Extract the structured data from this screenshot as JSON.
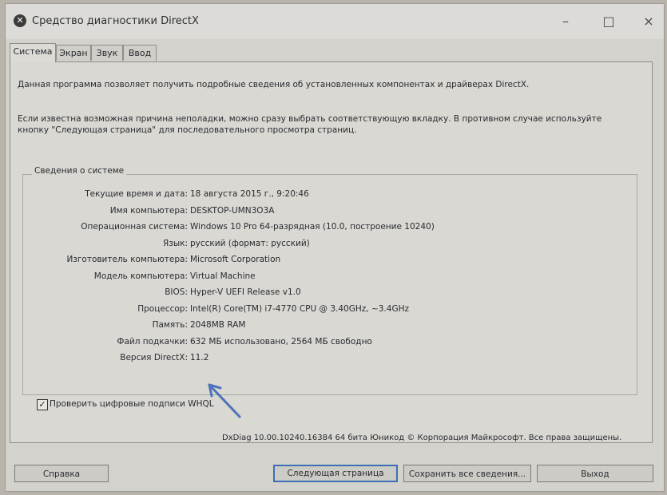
{
  "window": {
    "title": "Средство диагностики DirectX",
    "controls": {
      "minimize": "–",
      "maximize": "□",
      "close": "×"
    }
  },
  "tabs": [
    "Система",
    "Экран",
    "Звук",
    "Ввод"
  ],
  "intro": {
    "line1": "Данная программа позволяет получить подробные сведения об установленных компонентах и драйверах DirectX.",
    "line2": "Если известна возможная причина неполадки, можно сразу выбрать соответствующую вкладку. В противном случае используйте кнопку \"Следующая страница\" для последовательного просмотра страниц."
  },
  "system_info": {
    "group_title": "Сведения о системе",
    "rows": [
      {
        "label": "Текущие время и дата:",
        "value": "18 августа 2015 г., 9:20:46"
      },
      {
        "label": "Имя компьютера:",
        "value": "DESKTOP-UMN3O3A"
      },
      {
        "label": "Операционная система:",
        "value": "Windows 10 Pro 64-разрядная (10.0, построение 10240)"
      },
      {
        "label": "Язык:",
        "value": "русский (формат: русский)"
      },
      {
        "label": "Изготовитель компьютера:",
        "value": "Microsoft Corporation"
      },
      {
        "label": "Модель компьютера:",
        "value": "Virtual Machine"
      },
      {
        "label": "BIOS:",
        "value": "Hyper-V UEFI Release v1.0"
      },
      {
        "label": "Процессор:",
        "value": "Intel(R) Core(TM) i7-4770 CPU @ 3.40GHz, ~3.4GHz"
      },
      {
        "label": "Память:",
        "value": "2048MB RAM"
      },
      {
        "label": "Файл подкачки:",
        "value": "632 МБ использовано, 2564 МБ свободно"
      },
      {
        "label": "Версия DirectX:",
        "value": "11.2"
      }
    ]
  },
  "whql_checkbox": {
    "label": "Проверить цифровые подписи WHQL",
    "checked": true
  },
  "footer": "DxDiag 10.00.10240.16384 64 бита Юникод © Корпорация Майкрософт. Все права защищены.",
  "buttons": {
    "help": "Справка",
    "next": "Следующая страница",
    "save": "Сохранить все сведения...",
    "exit": "Выход"
  },
  "colors": {
    "annotation_arrow": "#4d73b8",
    "default_button_border": "#3e6fb3"
  }
}
